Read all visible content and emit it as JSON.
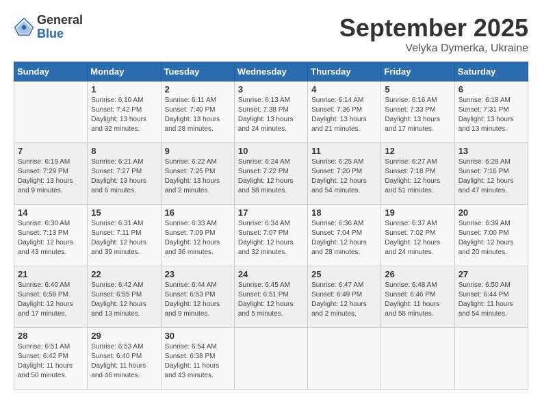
{
  "header": {
    "logo_general": "General",
    "logo_blue": "Blue",
    "month_title": "September 2025",
    "location": "Velyka Dymerka, Ukraine"
  },
  "days_of_week": [
    "Sunday",
    "Monday",
    "Tuesday",
    "Wednesday",
    "Thursday",
    "Friday",
    "Saturday"
  ],
  "weeks": [
    [
      {
        "day": "",
        "sunrise": "",
        "sunset": "",
        "daylight": ""
      },
      {
        "day": "1",
        "sunrise": "Sunrise: 6:10 AM",
        "sunset": "Sunset: 7:42 PM",
        "daylight": "Daylight: 13 hours and 32 minutes."
      },
      {
        "day": "2",
        "sunrise": "Sunrise: 6:11 AM",
        "sunset": "Sunset: 7:40 PM",
        "daylight": "Daylight: 13 hours and 28 minutes."
      },
      {
        "day": "3",
        "sunrise": "Sunrise: 6:13 AM",
        "sunset": "Sunset: 7:38 PM",
        "daylight": "Daylight: 13 hours and 24 minutes."
      },
      {
        "day": "4",
        "sunrise": "Sunrise: 6:14 AM",
        "sunset": "Sunset: 7:36 PM",
        "daylight": "Daylight: 13 hours and 21 minutes."
      },
      {
        "day": "5",
        "sunrise": "Sunrise: 6:16 AM",
        "sunset": "Sunset: 7:33 PM",
        "daylight": "Daylight: 13 hours and 17 minutes."
      },
      {
        "day": "6",
        "sunrise": "Sunrise: 6:18 AM",
        "sunset": "Sunset: 7:31 PM",
        "daylight": "Daylight: 13 hours and 13 minutes."
      }
    ],
    [
      {
        "day": "7",
        "sunrise": "Sunrise: 6:19 AM",
        "sunset": "Sunset: 7:29 PM",
        "daylight": "Daylight: 13 hours and 9 minutes."
      },
      {
        "day": "8",
        "sunrise": "Sunrise: 6:21 AM",
        "sunset": "Sunset: 7:27 PM",
        "daylight": "Daylight: 13 hours and 6 minutes."
      },
      {
        "day": "9",
        "sunrise": "Sunrise: 6:22 AM",
        "sunset": "Sunset: 7:25 PM",
        "daylight": "Daylight: 13 hours and 2 minutes."
      },
      {
        "day": "10",
        "sunrise": "Sunrise: 6:24 AM",
        "sunset": "Sunset: 7:22 PM",
        "daylight": "Daylight: 12 hours and 58 minutes."
      },
      {
        "day": "11",
        "sunrise": "Sunrise: 6:25 AM",
        "sunset": "Sunset: 7:20 PM",
        "daylight": "Daylight: 12 hours and 54 minutes."
      },
      {
        "day": "12",
        "sunrise": "Sunrise: 6:27 AM",
        "sunset": "Sunset: 7:18 PM",
        "daylight": "Daylight: 12 hours and 51 minutes."
      },
      {
        "day": "13",
        "sunrise": "Sunrise: 6:28 AM",
        "sunset": "Sunset: 7:16 PM",
        "daylight": "Daylight: 12 hours and 47 minutes."
      }
    ],
    [
      {
        "day": "14",
        "sunrise": "Sunrise: 6:30 AM",
        "sunset": "Sunset: 7:13 PM",
        "daylight": "Daylight: 12 hours and 43 minutes."
      },
      {
        "day": "15",
        "sunrise": "Sunrise: 6:31 AM",
        "sunset": "Sunset: 7:11 PM",
        "daylight": "Daylight: 12 hours and 39 minutes."
      },
      {
        "day": "16",
        "sunrise": "Sunrise: 6:33 AM",
        "sunset": "Sunset: 7:09 PM",
        "daylight": "Daylight: 12 hours and 36 minutes."
      },
      {
        "day": "17",
        "sunrise": "Sunrise: 6:34 AM",
        "sunset": "Sunset: 7:07 PM",
        "daylight": "Daylight: 12 hours and 32 minutes."
      },
      {
        "day": "18",
        "sunrise": "Sunrise: 6:36 AM",
        "sunset": "Sunset: 7:04 PM",
        "daylight": "Daylight: 12 hours and 28 minutes."
      },
      {
        "day": "19",
        "sunrise": "Sunrise: 6:37 AM",
        "sunset": "Sunset: 7:02 PM",
        "daylight": "Daylight: 12 hours and 24 minutes."
      },
      {
        "day": "20",
        "sunrise": "Sunrise: 6:39 AM",
        "sunset": "Sunset: 7:00 PM",
        "daylight": "Daylight: 12 hours and 20 minutes."
      }
    ],
    [
      {
        "day": "21",
        "sunrise": "Sunrise: 6:40 AM",
        "sunset": "Sunset: 6:58 PM",
        "daylight": "Daylight: 12 hours and 17 minutes."
      },
      {
        "day": "22",
        "sunrise": "Sunrise: 6:42 AM",
        "sunset": "Sunset: 6:55 PM",
        "daylight": "Daylight: 12 hours and 13 minutes."
      },
      {
        "day": "23",
        "sunrise": "Sunrise: 6:44 AM",
        "sunset": "Sunset: 6:53 PM",
        "daylight": "Daylight: 12 hours and 9 minutes."
      },
      {
        "day": "24",
        "sunrise": "Sunrise: 6:45 AM",
        "sunset": "Sunset: 6:51 PM",
        "daylight": "Daylight: 12 hours and 5 minutes."
      },
      {
        "day": "25",
        "sunrise": "Sunrise: 6:47 AM",
        "sunset": "Sunset: 6:49 PM",
        "daylight": "Daylight: 12 hours and 2 minutes."
      },
      {
        "day": "26",
        "sunrise": "Sunrise: 6:48 AM",
        "sunset": "Sunset: 6:46 PM",
        "daylight": "Daylight: 11 hours and 58 minutes."
      },
      {
        "day": "27",
        "sunrise": "Sunrise: 6:50 AM",
        "sunset": "Sunset: 6:44 PM",
        "daylight": "Daylight: 11 hours and 54 minutes."
      }
    ],
    [
      {
        "day": "28",
        "sunrise": "Sunrise: 6:51 AM",
        "sunset": "Sunset: 6:42 PM",
        "daylight": "Daylight: 11 hours and 50 minutes."
      },
      {
        "day": "29",
        "sunrise": "Sunrise: 6:53 AM",
        "sunset": "Sunset: 6:40 PM",
        "daylight": "Daylight: 11 hours and 46 minutes."
      },
      {
        "day": "30",
        "sunrise": "Sunrise: 6:54 AM",
        "sunset": "Sunset: 6:38 PM",
        "daylight": "Daylight: 11 hours and 43 minutes."
      },
      {
        "day": "",
        "sunrise": "",
        "sunset": "",
        "daylight": ""
      },
      {
        "day": "",
        "sunrise": "",
        "sunset": "",
        "daylight": ""
      },
      {
        "day": "",
        "sunrise": "",
        "sunset": "",
        "daylight": ""
      },
      {
        "day": "",
        "sunrise": "",
        "sunset": "",
        "daylight": ""
      }
    ]
  ]
}
